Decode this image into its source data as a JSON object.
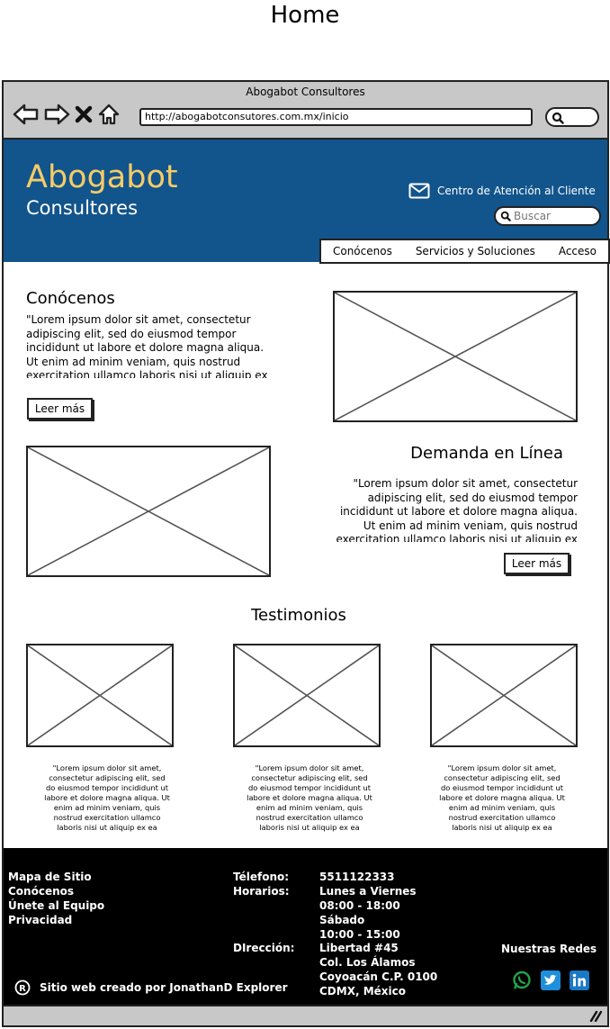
{
  "page": {
    "heading": "Home"
  },
  "browser": {
    "title": "Abogabot Consultores",
    "url": "http://abogabotconsutores.com.mx/inicio"
  },
  "header": {
    "brand_line1": "Abogabot",
    "brand_line2": "Consultores",
    "contact_label": "Centro de Atención al Cliente",
    "search_placeholder": "Buscar",
    "colors": {
      "background": "#12548c",
      "brand_accent": "#f5cc66"
    },
    "nav": [
      "Conócenos",
      "Servicios y Soluciones",
      "Acceso"
    ]
  },
  "sections": {
    "conocenos": {
      "title": "Conócenos",
      "text": "\"Lorem ipsum dolor sit amet, consectetur adipiscing elit, sed do eiusmod tempor incididunt ut labore et dolore magna aliqua. Ut enim ad minim veniam, quis nostrud exercitation ullamco laboris nisi ut aliquip ex",
      "button": "Leer más"
    },
    "demanda": {
      "title": "Demanda en Línea",
      "text": "\"Lorem ipsum dolor sit amet, consectetur adipiscing elit, sed do eiusmod tempor incididunt ut labore et dolore magna aliqua. Ut enim ad minim veniam, quis nostrud exercitation ullamco laboris nisi ut aliquip ex",
      "button": "Leer más"
    },
    "testimonios": {
      "title": "Testimonios",
      "items": [
        {
          "text": "\"Lorem ipsum dolor sit amet, consectetur adipiscing elit, sed do eiusmod tempor incididunt ut labore et dolore magna aliqua. Ut enim ad minim veniam, quis nostrud exercitation ullamco laboris nisi ut aliquip ex ea"
        },
        {
          "text": "\"Lorem ipsum dolor sit amet, consectetur adipiscing elit, sed do eiusmod tempor incididunt ut labore et dolore magna aliqua. Ut enim ad minim veniam, quis nostrud exercitation ullamco laboris nisi ut aliquip ex ea"
        },
        {
          "text": "\"Lorem ipsum dolor sit amet, consectetur adipiscing elit, sed do eiusmod tempor incididunt ut labore et dolore magna aliqua. Ut enim ad minim veniam, quis nostrud exercitation ullamco laboris nisi ut aliquip ex ea"
        }
      ]
    }
  },
  "footer": {
    "links": [
      "Mapa de Sitio",
      "Conócenos",
      "Únete al Equipo",
      "Privacidad"
    ],
    "telefono_label": "Télefono:",
    "telefono": "5511122333",
    "horarios_label": "Horarios:",
    "horarios": [
      "Lunes a Viernes",
      "08:00 - 18:00",
      "Sábado",
      "10:00 - 15:00"
    ],
    "direccion_label": "DIrección:",
    "direccion": [
      "Libertad #45",
      "Col. Los Álamos",
      "Coyoacán C.P. 0100",
      "CDMX, México"
    ],
    "redes_label": "Nuestras Redes",
    "social_icons": [
      "whatsapp-icon",
      "twitter-icon",
      "linkedin-icon"
    ],
    "credit": "Sitio web creado por JonathanD Explorer",
    "colors": {
      "whatsapp": "#25a244",
      "twitter": "#1d8fdb",
      "linkedin": "#1b78c4"
    }
  }
}
